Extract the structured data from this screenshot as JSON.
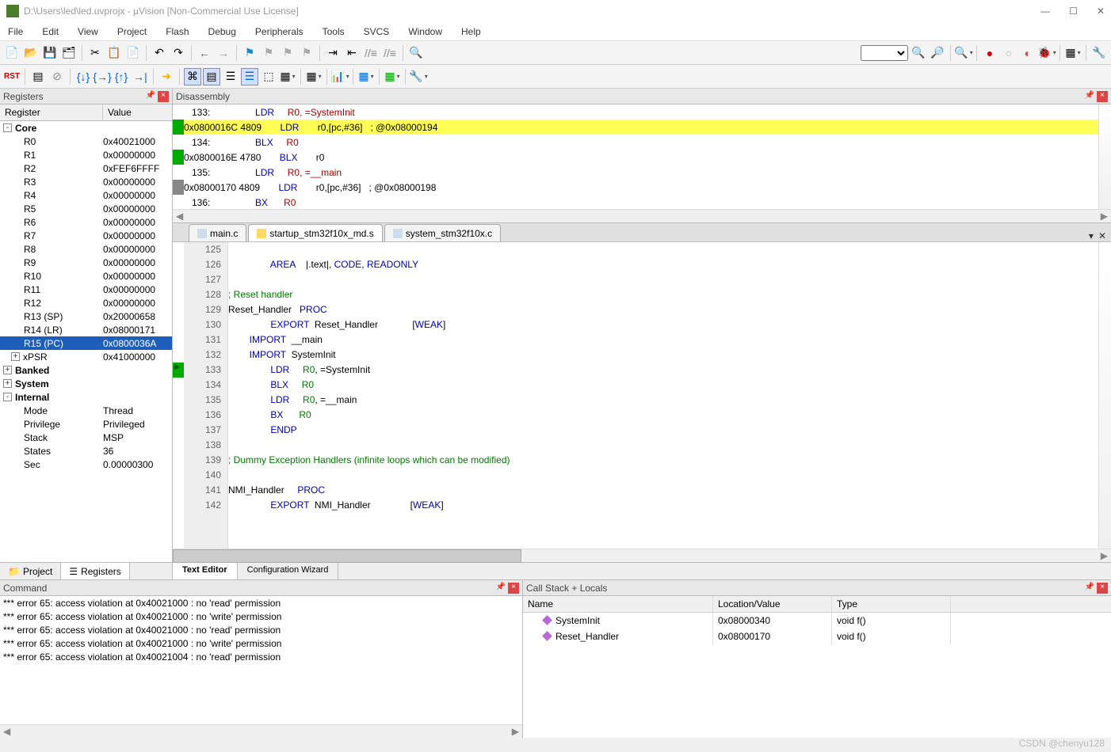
{
  "title": "D:\\Users\\led\\led.uvprojx - µVision  [Non-Commercial Use License]",
  "menu": [
    "File",
    "Edit",
    "View",
    "Project",
    "Flash",
    "Debug",
    "Peripherals",
    "Tools",
    "SVCS",
    "Window",
    "Help"
  ],
  "panels": {
    "registers": "Registers",
    "disassembly": "Disassembly",
    "command": "Command",
    "callstack": "Call Stack + Locals"
  },
  "reg_headers": {
    "c1": "Register",
    "c2": "Value"
  },
  "reg_tree": [
    {
      "type": "group",
      "exp": "-",
      "name": "Core",
      "items": [
        {
          "n": "R0",
          "v": "0x40021000"
        },
        {
          "n": "R1",
          "v": "0x00000000"
        },
        {
          "n": "R2",
          "v": "0xFEF6FFFF"
        },
        {
          "n": "R3",
          "v": "0x00000000"
        },
        {
          "n": "R4",
          "v": "0x00000000"
        },
        {
          "n": "R5",
          "v": "0x00000000"
        },
        {
          "n": "R6",
          "v": "0x00000000"
        },
        {
          "n": "R7",
          "v": "0x00000000"
        },
        {
          "n": "R8",
          "v": "0x00000000"
        },
        {
          "n": "R9",
          "v": "0x00000000"
        },
        {
          "n": "R10",
          "v": "0x00000000"
        },
        {
          "n": "R11",
          "v": "0x00000000"
        },
        {
          "n": "R12",
          "v": "0x00000000"
        },
        {
          "n": "R13 (SP)",
          "v": "0x20000658"
        },
        {
          "n": "R14 (LR)",
          "v": "0x08000171"
        },
        {
          "n": "R15 (PC)",
          "v": "0x0800036A",
          "sel": true
        },
        {
          "exp": "+",
          "n": "xPSR",
          "v": "0x41000000"
        }
      ]
    },
    {
      "type": "group",
      "exp": "+",
      "name": "Banked"
    },
    {
      "type": "group",
      "exp": "+",
      "name": "System"
    },
    {
      "type": "group",
      "exp": "-",
      "name": "Internal",
      "items": [
        {
          "n": "Mode",
          "v": "Thread"
        },
        {
          "n": "Privilege",
          "v": "Privileged"
        },
        {
          "n": "Stack",
          "v": "MSP"
        },
        {
          "n": "States",
          "v": "36"
        },
        {
          "n": "Sec",
          "v": "0.00000300"
        }
      ]
    }
  ],
  "reg_tabs": {
    "project": "Project",
    "registers": "Registers"
  },
  "disasm_lines": [
    {
      "g": "",
      "src": true,
      "ln": "   133:",
      "op": "LDR",
      "args": "R0, =SystemInit"
    },
    {
      "g": "g1",
      "hl": true,
      "addr": "0x0800016C 4809",
      "op": "LDR",
      "args": "r0,[pc,#36]   ; @0x08000194"
    },
    {
      "g": "",
      "src": true,
      "ln": "   134:",
      "op": "BLX",
      "args": "R0"
    },
    {
      "g": "g1",
      "addr": "0x0800016E 4780",
      "op": "BLX",
      "args": "r0"
    },
    {
      "g": "",
      "src": true,
      "ln": "   135:",
      "op": "LDR",
      "args": "R0, =__main"
    },
    {
      "g": "g2",
      "addr": "0x08000170 4809",
      "op": "LDR",
      "args": "r0,[pc,#36]   ; @0x08000198"
    },
    {
      "g": "",
      "src": true,
      "ln": "   136:",
      "op": "BX",
      "args": "R0"
    }
  ],
  "editor_tabs": [
    {
      "name": "main.c",
      "icon": "fi-c"
    },
    {
      "name": "startup_stm32f10x_md.s",
      "icon": "fi-s",
      "active": true
    },
    {
      "name": "system_stm32f10x.c",
      "icon": "fi-c"
    }
  ],
  "code_start": 125,
  "code_lines": [
    "",
    "                AREA    |.text|, CODE, READONLY",
    "",
    "; Reset handler",
    "Reset_Handler   PROC",
    "                EXPORT  Reset_Handler             [WEAK]",
    "        IMPORT  __main",
    "        IMPORT  SystemInit",
    "                LDR     R0, =SystemInit",
    "                BLX     R0",
    "                LDR     R0, =__main",
    "                BX      R0",
    "                ENDP",
    "",
    "; Dummy Exception Handlers (infinite loops which can be modified)",
    "",
    "NMI_Handler     PROC",
    "                EXPORT  NMI_Handler               [WEAK]"
  ],
  "code_current": 133,
  "ed_bottom_tabs": {
    "te": "Text Editor",
    "cw": "Configuration Wizard"
  },
  "cmd_lines": [
    "*** error 65: access violation at 0x40021000 : no 'read' permission",
    "*** error 65: access violation at 0x40021000 : no 'write' permission",
    "*** error 65: access violation at 0x40021000 : no 'read' permission",
    "*** error 65: access violation at 0x40021000 : no 'write' permission",
    "*** error 65: access violation at 0x40021004 : no 'read' permission"
  ],
  "cs_headers": {
    "c1": "Name",
    "c2": "Location/Value",
    "c3": "Type"
  },
  "cs_rows": [
    {
      "n": "SystemInit",
      "l": "0x08000340",
      "t": "void f()"
    },
    {
      "n": "Reset_Handler",
      "l": "0x08000170",
      "t": "void f()"
    }
  ],
  "watermark": "CSDN @chenyu128"
}
